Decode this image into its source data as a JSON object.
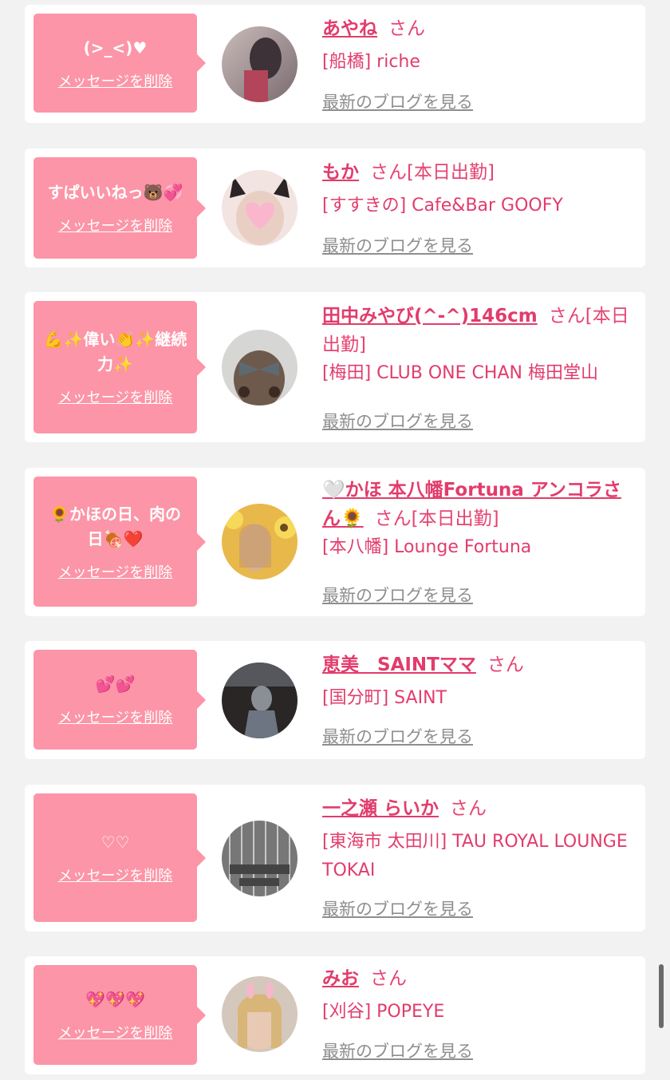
{
  "delete_label": "メッセージを削除",
  "blog_label": "最新のブログを見る",
  "san_label": "さん",
  "cards": [
    {
      "message": "(>_<)♥",
      "name": "あやね",
      "status": "",
      "shop": "[船橋] riche",
      "avatar_colors": [
        "#b8a7a3",
        "#5a4a52"
      ]
    },
    {
      "message": "すぱいいねっ🐻💞",
      "name": "もか",
      "status": "[本日出勤]",
      "shop": "[すすきの] Cafe&Bar GOOFY",
      "avatar_colors": [
        "#f4e7e4",
        "#f7b8cc"
      ]
    },
    {
      "message": "💪✨偉い👏✨継続力✨",
      "name": "田中みやび(^-^)146cm",
      "status": "[本日出勤]",
      "shop": "[梅田] CLUB ONE CHAN 梅田堂山",
      "avatar_colors": [
        "#dcdcdc",
        "#6d5a4e"
      ]
    },
    {
      "message": "🌻かほの日、肉の日🍖❤️",
      "name": "🤍かほ 本八幡Fortuna アンコラさん🌻",
      "status": "[本日出勤]",
      "shop": "[本八幡] Lounge Fortuna",
      "avatar_colors": [
        "#f2c74a",
        "#d9a05e"
      ]
    },
    {
      "message": "💕💕",
      "name": "恵美　SAINTママ",
      "status": "",
      "shop": "[国分町] SAINT",
      "avatar_colors": [
        "#2e2a2a",
        "#7b7f8a"
      ]
    },
    {
      "message": "♡♡",
      "name": "一之瀬 らいか",
      "status": "",
      "shop": "[東海市 太田川] TAU ROYAL LOUNGE TOKAI",
      "avatar_colors": [
        "#8a8a8a",
        "#3a3a3a"
      ]
    },
    {
      "message": "💖💖💖",
      "name": "みお",
      "status": "",
      "shop": "[刈谷] POPEYE",
      "avatar_colors": [
        "#d8c9bc",
        "#e9c6b4"
      ]
    }
  ]
}
